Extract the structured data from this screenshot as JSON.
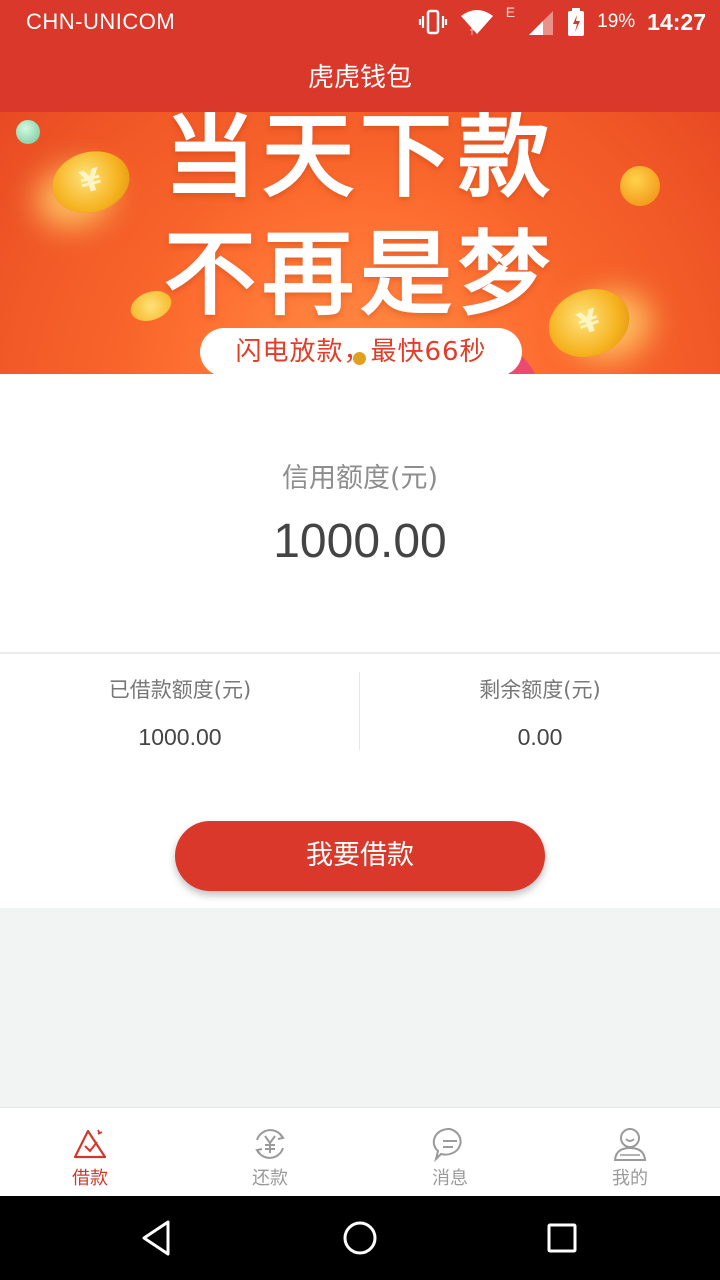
{
  "status_bar": {
    "carrier": "CHN-UNICOM",
    "network_label": "E",
    "battery": "19%",
    "time": "14:27",
    "icons": [
      "vibrate-icon",
      "wifi-icon",
      "signal-icon",
      "battery-icon"
    ]
  },
  "header": {
    "title": "虎虎钱包"
  },
  "banner": {
    "line1": "当天下款",
    "line2": "不再是梦",
    "pill_text": "闪电放款，最快66秒",
    "coin_symbol": "¥"
  },
  "credit": {
    "limit_label": "信用额度(元)",
    "limit_value": "1000.00",
    "borrowed_label": "已借款额度(元)",
    "borrowed_value": "1000.00",
    "remaining_label": "剩余额度(元)",
    "remaining_value": "0.00",
    "borrow_button": "我要借款"
  },
  "tabs": [
    {
      "label": "借款",
      "icon": "borrow-icon",
      "active": true
    },
    {
      "label": "还款",
      "icon": "repay-icon",
      "active": false
    },
    {
      "label": "消息",
      "icon": "message-icon",
      "active": false
    },
    {
      "label": "我的",
      "icon": "profile-icon",
      "active": false
    }
  ],
  "colors": {
    "primary": "#d9382a",
    "banner": "#f25a27",
    "tab_active": "#d0382a",
    "tab_inactive": "#9a9a9a"
  },
  "nav": {
    "icons": [
      "back-icon",
      "home-icon",
      "recents-icon"
    ]
  }
}
